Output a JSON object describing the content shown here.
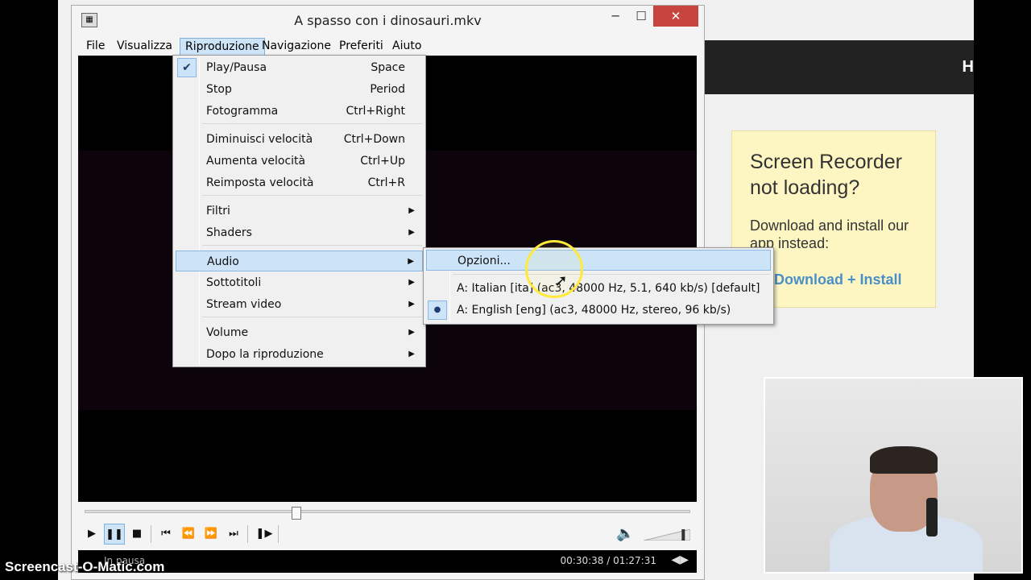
{
  "window": {
    "title": "A spasso con i dinosauri.mkv",
    "app_icon": "video-player-icon",
    "minimize": "─",
    "maximize": "☐",
    "close": "✕"
  },
  "menubar": {
    "items": [
      "File",
      "Visualizza",
      "Riproduzione",
      "Navigazione",
      "Preferiti",
      "Aiuto"
    ],
    "active": "Riproduzione"
  },
  "playback_menu": {
    "items": [
      {
        "label": "Play/Pausa",
        "shortcut": "Space",
        "checked": true
      },
      {
        "label": "Stop",
        "shortcut": "Period"
      },
      {
        "label": "Fotogramma",
        "shortcut": "Ctrl+Right"
      },
      {
        "label": "Diminuisci velocità",
        "shortcut": "Ctrl+Down"
      },
      {
        "label": "Aumenta velocità",
        "shortcut": "Ctrl+Up"
      },
      {
        "label": "Reimposta velocità",
        "shortcut": "Ctrl+R"
      },
      {
        "label": "Filtri",
        "submenu": true
      },
      {
        "label": "Shaders",
        "submenu": true
      },
      {
        "label": "Audio",
        "submenu": true,
        "highlighted": true
      },
      {
        "label": "Sottotitoli",
        "submenu": true
      },
      {
        "label": "Stream video",
        "submenu": true
      },
      {
        "label": "Volume",
        "submenu": true
      },
      {
        "label": "Dopo la riproduzione",
        "submenu": true
      }
    ],
    "check_glyph": "✔",
    "arrow_glyph": "▶"
  },
  "audio_submenu": {
    "items": [
      {
        "label": "Opzioni...",
        "highlighted": true
      },
      {
        "label": "A: Italian [ita] (ac3, 48000 Hz, 5.1, 640 kb/s) [default]"
      },
      {
        "label": "A: English [eng] (ac3, 48000 Hz, stereo, 96 kb/s)",
        "selected": true
      }
    ],
    "bullet_glyph": "●"
  },
  "controls": {
    "play": "▶",
    "pause": "❚❚",
    "stop": "■",
    "prev": "⏮",
    "rewind": "⏪",
    "forward": "⏩",
    "next": "⏭",
    "frame_step": "❚▶",
    "volume_icon": "🔈",
    "seek_position_fraction": 0.35,
    "volume_fraction": 0.85
  },
  "status": {
    "state": "In pausa",
    "time": "00:30:38 / 01:27:31",
    "signal_icon": "◀▶"
  },
  "ad": {
    "title": "Screen Recorder not loading?",
    "text": "Download and install our app instead:",
    "link": "Download + Install"
  },
  "page_header_fragment": "H",
  "watermark": "Screencast-O-Matic.com",
  "colors": {
    "menu_highlight": "#cde3f7",
    "close_button": "#c7453c",
    "ad_background": "#fdf6c3",
    "link": "#4a90c8"
  }
}
